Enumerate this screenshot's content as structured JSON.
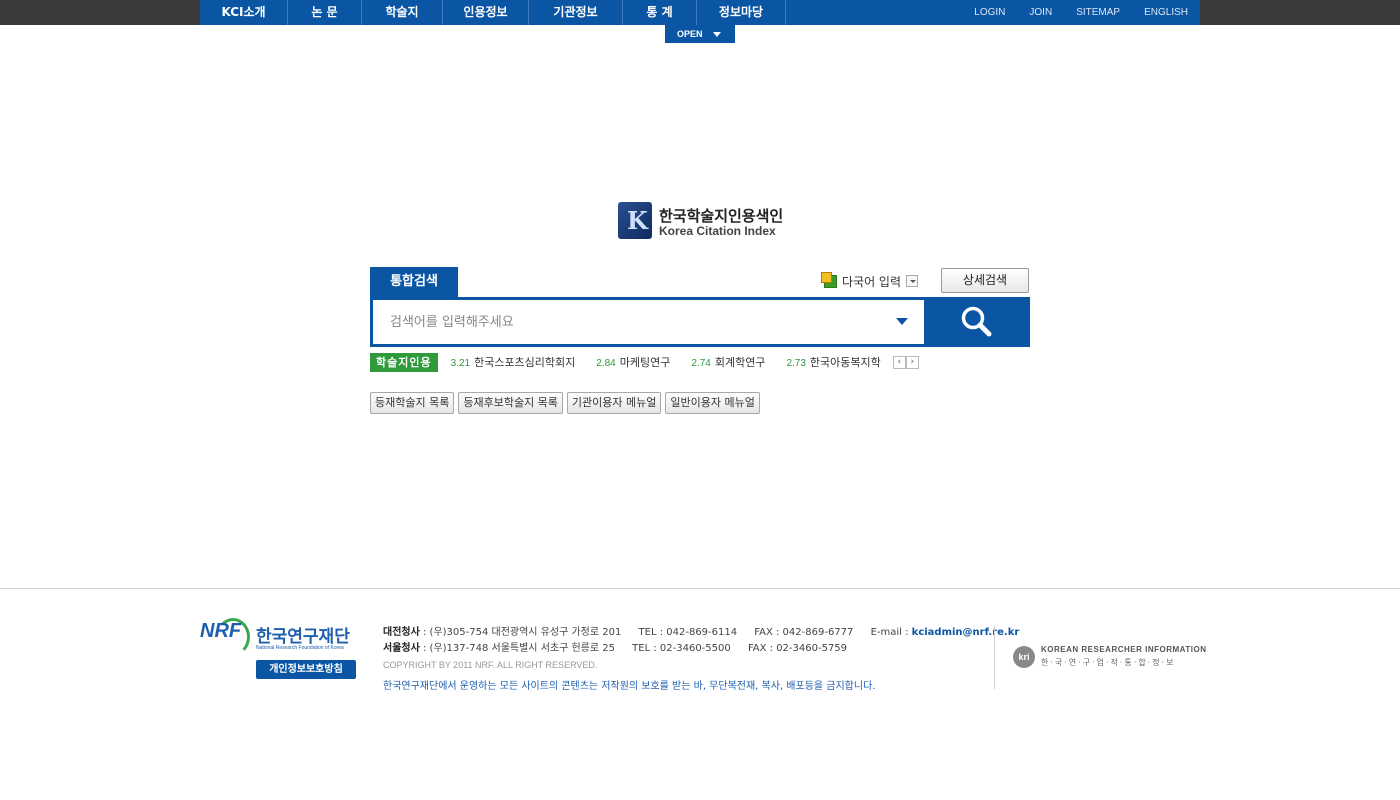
{
  "nav": {
    "items": [
      {
        "label": "KCI소개"
      },
      {
        "label": "논 문"
      },
      {
        "label": "학술지"
      },
      {
        "label": "인용정보"
      },
      {
        "label": "기관정보"
      },
      {
        "label": "통 계"
      },
      {
        "label": "정보마당"
      }
    ],
    "util": [
      {
        "label": "LOGIN"
      },
      {
        "label": "JOIN"
      },
      {
        "label": "SITEMAP"
      },
      {
        "label": "ENGLISH"
      }
    ],
    "open_label": "OPEN"
  },
  "logo": {
    "korean": "한국학술지인용색인",
    "english": "Korea Citation Index"
  },
  "search": {
    "tab_label": "통합검색",
    "multilang_label": "다국어 입력",
    "advanced_label": "상세검색",
    "placeholder": "검색어를 입력해주세요"
  },
  "ticker": {
    "label": "학술지인용",
    "items": [
      {
        "score": "3.21",
        "name": "한국스포츠심리학회지"
      },
      {
        "score": "2.84",
        "name": "마케팅연구"
      },
      {
        "score": "2.74",
        "name": "회계학연구"
      },
      {
        "score": "2.73",
        "name": "한국아동복지학"
      }
    ]
  },
  "quick_links": [
    {
      "label": "등재학술지 목록"
    },
    {
      "label": "등재후보학술지 목록"
    },
    {
      "label": "기관이용자 메뉴얼"
    },
    {
      "label": "일반이용자 메뉴얼"
    }
  ],
  "footer": {
    "nrf_mark": "NRF",
    "nrf_korean": "한국연구재단",
    "nrf_english": "National Research Foundation of Korea",
    "privacy_label": "개인정보보호방침",
    "daejeon_label": "대전청사",
    "daejeon_addr": ": (우)305-754 대전광역시 유성구 가정로 201",
    "daejeon_tel": "TEL : 042-869-6114",
    "daejeon_fax": "FAX : 042-869-6777",
    "email_label": "E-mail :",
    "email": "kciadmin@nrf.re.kr",
    "seoul_label": "서울청사",
    "seoul_addr": ": (우)137-748 서울특별시 서초구 헌릉로 25",
    "seoul_tel": "TEL : 02-3460-5500",
    "seoul_fax": "FAX : 02-3460-5759",
    "copyright": "COPYRIGHT BY 2011 NRF. ALL RIGHT RESERVED.",
    "notice": "한국연구재단에서 운영하는 모든 사이트의 콘텐츠는 저작원의 보호를 받는 바, 무단복전재, 복사, 배포등을 금지합니다.",
    "kri_mark": "kri",
    "kri_english": "KOREAN RESEARCHER INFORMATION",
    "kri_korean": "한·국·연·구·업·적·통·합·정·보"
  },
  "colors": {
    "brand_blue": "#0a56a4",
    "ticker_green": "#2f9a3a",
    "topbar_dark": "#3a3a3a"
  }
}
